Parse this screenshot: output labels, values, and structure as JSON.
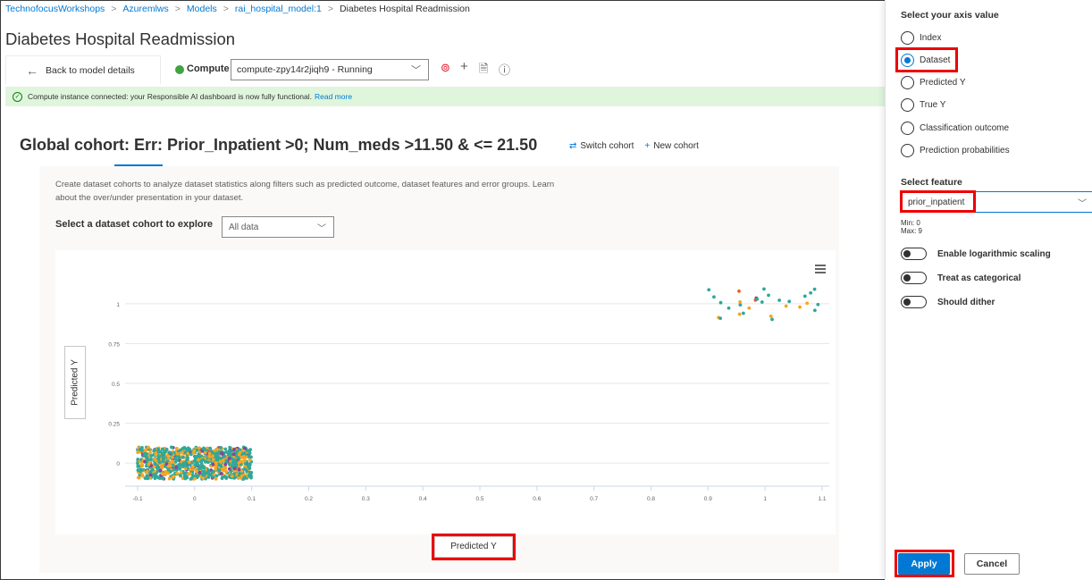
{
  "breadcrumb": [
    "TechnofocusWorkshops",
    "Azuremlws",
    "Models",
    "rai_hospital_model:1",
    "Diabetes Hospital Readmission"
  ],
  "page_title": "Diabetes Hospital Readmission",
  "toolbar": {
    "back_label": "Back to model details",
    "compute_label": "Compute",
    "compute_value": "compute-zpy14r2jiqh9 - Running"
  },
  "banner": {
    "text": "Compute instance connected: your Responsible AI dashboard is now fully functional.",
    "link": "Read more"
  },
  "cohort": {
    "title": "Global cohort: Err: Prior_Inpatient >0; Num_meds >11.50 & <= 21.50",
    "switch_label": "Switch cohort",
    "new_label": "New cohort"
  },
  "explorer": {
    "description": "Create dataset cohorts to analyze dataset statistics along filters such as predicted outcome, dataset features and error groups. Learn about the over/under presentation in your dataset.",
    "select_label": "Select a dataset cohort to explore",
    "select_value": "All data"
  },
  "chart_data": {
    "type": "scatter",
    "xlabel": "Predicted Y",
    "ylabel": "Predicted Y",
    "x_ticks": [
      "-0.1",
      "0",
      "0.1",
      "0.2",
      "0.3",
      "0.4",
      "0.5",
      "0.6",
      "0.7",
      "0.8",
      "0.9",
      "1",
      "1.1"
    ],
    "y_ticks": [
      "0",
      "0.25",
      "0.5",
      "0.75",
      "1"
    ],
    "xlim": [
      -0.1,
      1.1
    ],
    "ylim": [
      -0.1,
      1.1
    ],
    "grid": true,
    "clusters": [
      {
        "x_range": [
          -0.1,
          0.1
        ],
        "y_range": [
          -0.1,
          0.1
        ],
        "density": "dense"
      },
      {
        "x_range": [
          0.9,
          1.1
        ],
        "y_range": [
          0.9,
          1.1
        ],
        "density": "sparse"
      }
    ],
    "point_colors": [
      "#2ea89a",
      "#f5a623",
      "#8e3fa0",
      "#e8642a"
    ]
  },
  "panel": {
    "axis_heading": "Select your axis value",
    "options": [
      "Index",
      "Dataset",
      "Predicted Y",
      "True Y",
      "Classification outcome",
      "Prediction probabilities"
    ],
    "selected_option": "Dataset",
    "feature_heading": "Select feature",
    "feature_value": "prior_inpatient",
    "min_text": "Min: 0",
    "max_text": "Max: 9",
    "toggles": [
      "Enable logarithmic scaling",
      "Treat as categorical",
      "Should dither"
    ],
    "apply_label": "Apply",
    "cancel_label": "Cancel"
  }
}
